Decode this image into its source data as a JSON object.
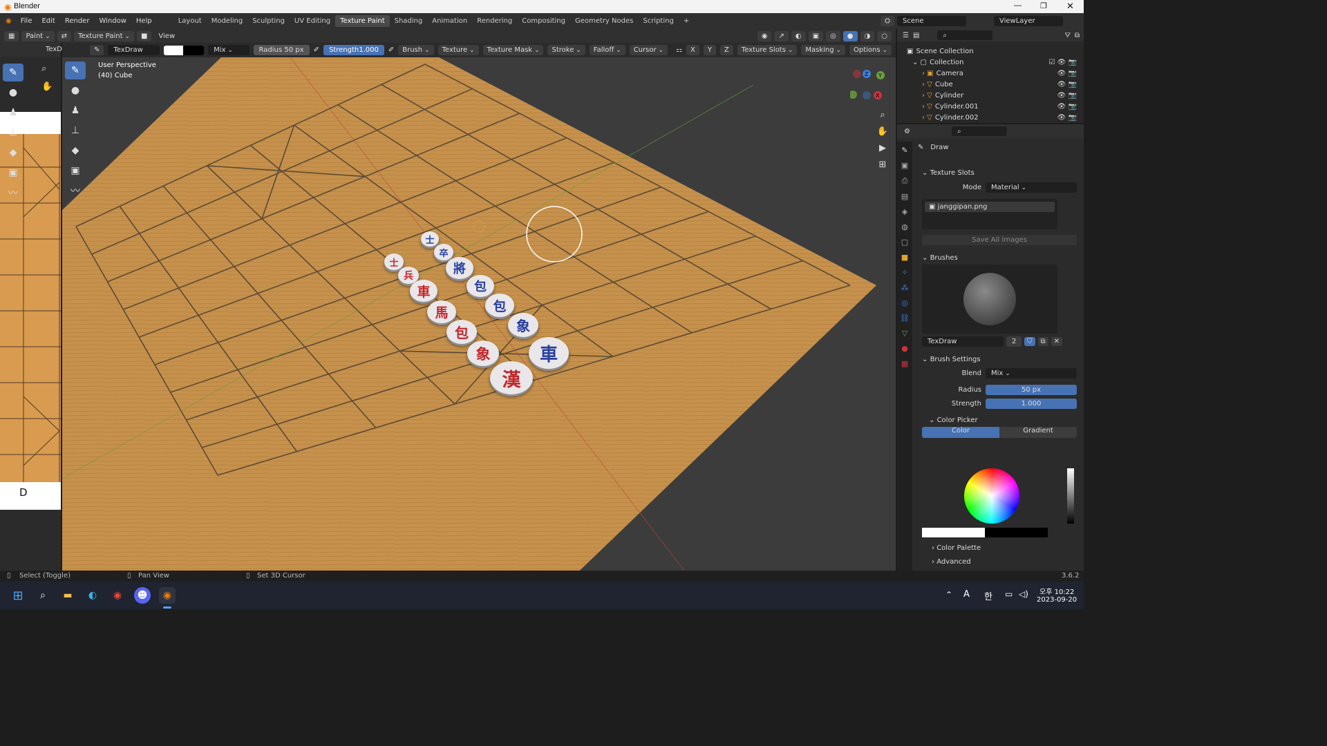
{
  "app": {
    "title": "Blender",
    "version": "3.6.2"
  },
  "menu": [
    "File",
    "Edit",
    "Render",
    "Window",
    "Help"
  ],
  "workspaces": [
    "Layout",
    "Modeling",
    "Sculpting",
    "UV Editing",
    "Texture Paint",
    "Shading",
    "Animation",
    "Rendering",
    "Compositing",
    "Geometry Nodes",
    "Scripting"
  ],
  "active_workspace": "Texture Paint",
  "scene": {
    "name": "Scene",
    "view_layer": "ViewLayer"
  },
  "header": {
    "mode": "Paint",
    "editor_mode": "Texture Paint",
    "view": "View"
  },
  "left_panel": {
    "label": "TexD",
    "letter": "D"
  },
  "toolbar": {
    "brush_name": "TexDraw",
    "blend": "Mix",
    "radius_label": "Radius",
    "radius_value": "50 px",
    "strength_label": "Strength",
    "strength_value": "1.000",
    "menus": [
      "Brush",
      "Texture",
      "Texture Mask",
      "Stroke",
      "Falloff",
      "Cursor"
    ],
    "axes": [
      "X",
      "Y",
      "Z"
    ],
    "right_menus": [
      "Texture Slots",
      "Masking",
      "Options"
    ]
  },
  "viewport": {
    "perspective": "User Perspective",
    "object": "(40) Cube"
  },
  "pieces": {
    "top": [
      "士",
      "卒",
      "將",
      "兵"
    ],
    "red": [
      "士",
      "兵",
      "車",
      "馬",
      "包",
      "象",
      "漢"
    ],
    "blue": [
      "將",
      "包",
      "象",
      "車"
    ]
  },
  "outliner": {
    "root": "Scene Collection",
    "collection": "Collection",
    "items": [
      "Camera",
      "Cube",
      "Cylinder",
      "Cylinder.001",
      "Cylinder.002"
    ]
  },
  "properties": {
    "tool_name": "Draw",
    "texture_slots": {
      "title": "Texture Slots",
      "mode_label": "Mode",
      "mode_value": "Material",
      "image": "janggipan.png",
      "save_button": "Save All Images"
    },
    "brushes": {
      "title": "Brushes",
      "name": "TexDraw",
      "users": "2"
    },
    "brush_settings": {
      "title": "Brush Settings",
      "blend_label": "Blend",
      "blend_value": "Mix",
      "radius_label": "Radius",
      "radius_value": "50 px",
      "strength_label": "Strength",
      "strength_value": "1.000"
    },
    "color_picker": {
      "title": "Color Picker",
      "tab_color": "Color",
      "tab_gradient": "Gradient"
    },
    "color_palette": "Color Palette",
    "advanced": "Advanced"
  },
  "status": {
    "select": "Select (Toggle)",
    "pan": "Pan View",
    "cursor": "Set 3D Cursor",
    "version": "3.6.2"
  },
  "taskbar": {
    "time": "오후 10:22",
    "date": "2023-09-20",
    "ime": "한",
    "lang": "A"
  },
  "colors": {
    "accent": "#4772b3",
    "board": "#c7924a",
    "board_line": "#5b4a35",
    "red_piece": "#c3262a",
    "blue_piece": "#283fa0"
  }
}
